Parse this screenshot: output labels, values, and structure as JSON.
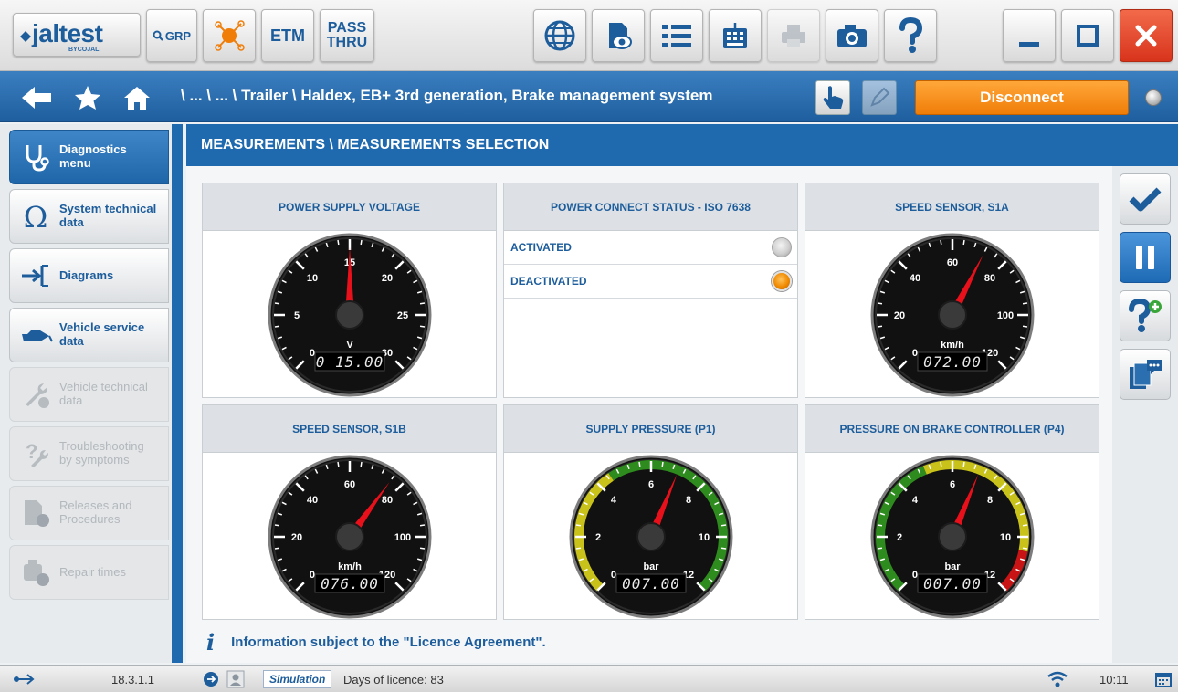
{
  "app": {
    "logo_text": "jaltest",
    "logo_sub": "BYCOJALI"
  },
  "toolbar": {
    "grp_label": "GRP",
    "etm_label": "ETM",
    "pass_thru_line1": "PASS",
    "pass_thru_line2": "THRU",
    "icons": [
      "search-icon",
      "network-icon",
      "globe-icon",
      "eye-document-icon",
      "list-icon",
      "keyboard-icon",
      "printer-icon",
      "camera-icon",
      "help-icon",
      "minimize-icon",
      "maximize-icon",
      "close-icon"
    ]
  },
  "nav": {
    "breadcrumb": "\\ ... \\ ... \\ Trailer \\ Haldex, EB+ 3rd generation, Brake management system",
    "disconnect_label": "Disconnect"
  },
  "sidebar": {
    "items": [
      {
        "label_line1": "Diagnostics",
        "label_line2": "menu",
        "icon": "stethoscope-icon",
        "state": "active"
      },
      {
        "label_line1": "System technical",
        "label_line2": "data",
        "icon": "omega-icon",
        "state": "normal"
      },
      {
        "label_line1": "Diagrams",
        "label_line2": "",
        "icon": "diagram-arrow-icon",
        "state": "normal"
      },
      {
        "label_line1": "Vehicle service",
        "label_line2": "data",
        "icon": "oil-can-icon",
        "state": "normal"
      },
      {
        "label_line1": "Vehicle technical",
        "label_line2": "data",
        "icon": "wrench-gear-icon",
        "state": "disabled"
      },
      {
        "label_line1": "Troubleshooting",
        "label_line2": "by symptoms",
        "icon": "question-wrench-icon",
        "state": "disabled"
      },
      {
        "label_line1": "Releases and",
        "label_line2": "Procedures",
        "icon": "document-gear-icon",
        "state": "disabled"
      },
      {
        "label_line1": "Repair times",
        "label_line2": "",
        "icon": "engine-gear-icon",
        "state": "disabled"
      }
    ]
  },
  "panel": {
    "title": "MEASUREMENTS \\ MEASUREMENTS SELECTION",
    "info": "Information subject to the \"Licence Agreement\"."
  },
  "cards": [
    {
      "title": "POWER SUPPLY VOLTAGE",
      "type": "gauge",
      "unit": "V",
      "ticks": [
        "0",
        "5",
        "10",
        "15",
        "20",
        "25",
        "30"
      ],
      "min": 0,
      "max": 30,
      "value": 15.0,
      "display": "0 15.00",
      "scale_color": "none"
    },
    {
      "title": "POWER CONNECT STATUS - ISO 7638",
      "type": "status",
      "rows": [
        {
          "label": "ACTIVATED",
          "on": false
        },
        {
          "label": "DEACTIVATED",
          "on": true
        }
      ]
    },
    {
      "title": "SPEED SENSOR, S1A",
      "type": "gauge",
      "unit": "km/h",
      "ticks": [
        "0",
        "20",
        "40",
        "60",
        "80",
        "100",
        "120"
      ],
      "min": 0,
      "max": 120,
      "value": 72.0,
      "display": "072.00",
      "scale_color": "none"
    },
    {
      "title": "SPEED SENSOR, S1B",
      "type": "gauge",
      "unit": "km/h",
      "ticks": [
        "0",
        "20",
        "40",
        "60",
        "80",
        "100",
        "120"
      ],
      "min": 0,
      "max": 120,
      "value": 76.0,
      "display": "076.00",
      "scale_color": "none"
    },
    {
      "title": "SUPPLY PRESSURE (P1)",
      "type": "gauge",
      "unit": "bar",
      "ticks": [
        "0",
        "2",
        "4",
        "6",
        "8",
        "10",
        "12"
      ],
      "min": 0,
      "max": 12,
      "value": 7.0,
      "display": "007.00",
      "scale_color": "supply"
    },
    {
      "title": "PRESSURE ON BRAKE CONTROLLER (P4)",
      "type": "gauge",
      "unit": "bar",
      "ticks": [
        "0",
        "2",
        "4",
        "6",
        "8",
        "10",
        "12"
      ],
      "min": 0,
      "max": 12,
      "value": 7.0,
      "display": "007.00",
      "scale_color": "controller"
    }
  ],
  "rightbar": {
    "icons": [
      "checkmark-icon",
      "pause-icon",
      "help-add-icon",
      "chat-documents-icon"
    ]
  },
  "statusbar": {
    "version": "18.3.1.1",
    "simulation": "Simulation",
    "licence": "Days of licence: 83",
    "time": "10:11"
  },
  "colors": {
    "brand_blue": "#1f6aaf",
    "accent_orange": "#f08a00",
    "needle_red": "#e8101a",
    "scale_green": "#2e8b1e",
    "scale_yellow": "#c8c21a",
    "scale_red": "#c81414"
  }
}
